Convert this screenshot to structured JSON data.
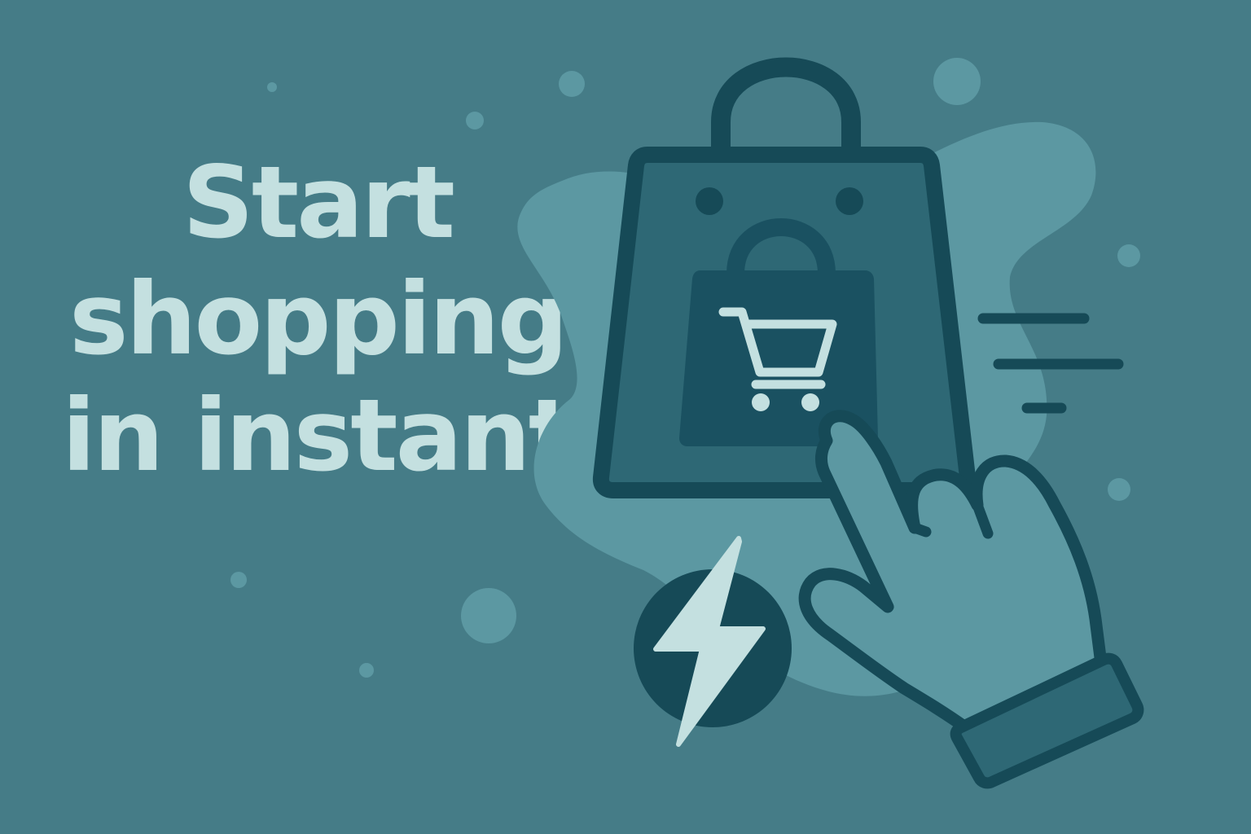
{
  "headline": {
    "lines": [
      "Start",
      "shopping",
      "in instant"
    ]
  },
  "colors": {
    "background": "#457c87",
    "blob": "#5c98a2",
    "dark_outline": "#164a57",
    "bag_fill": "#2e6875",
    "inner_bag": "#1a5161",
    "light_accent": "#c4e0e0"
  },
  "icons": [
    "shopping-bag-icon",
    "small-bag-icon",
    "cart-icon",
    "pointing-hand-icon",
    "lightning-bolt-icon",
    "speed-lines-icon"
  ]
}
